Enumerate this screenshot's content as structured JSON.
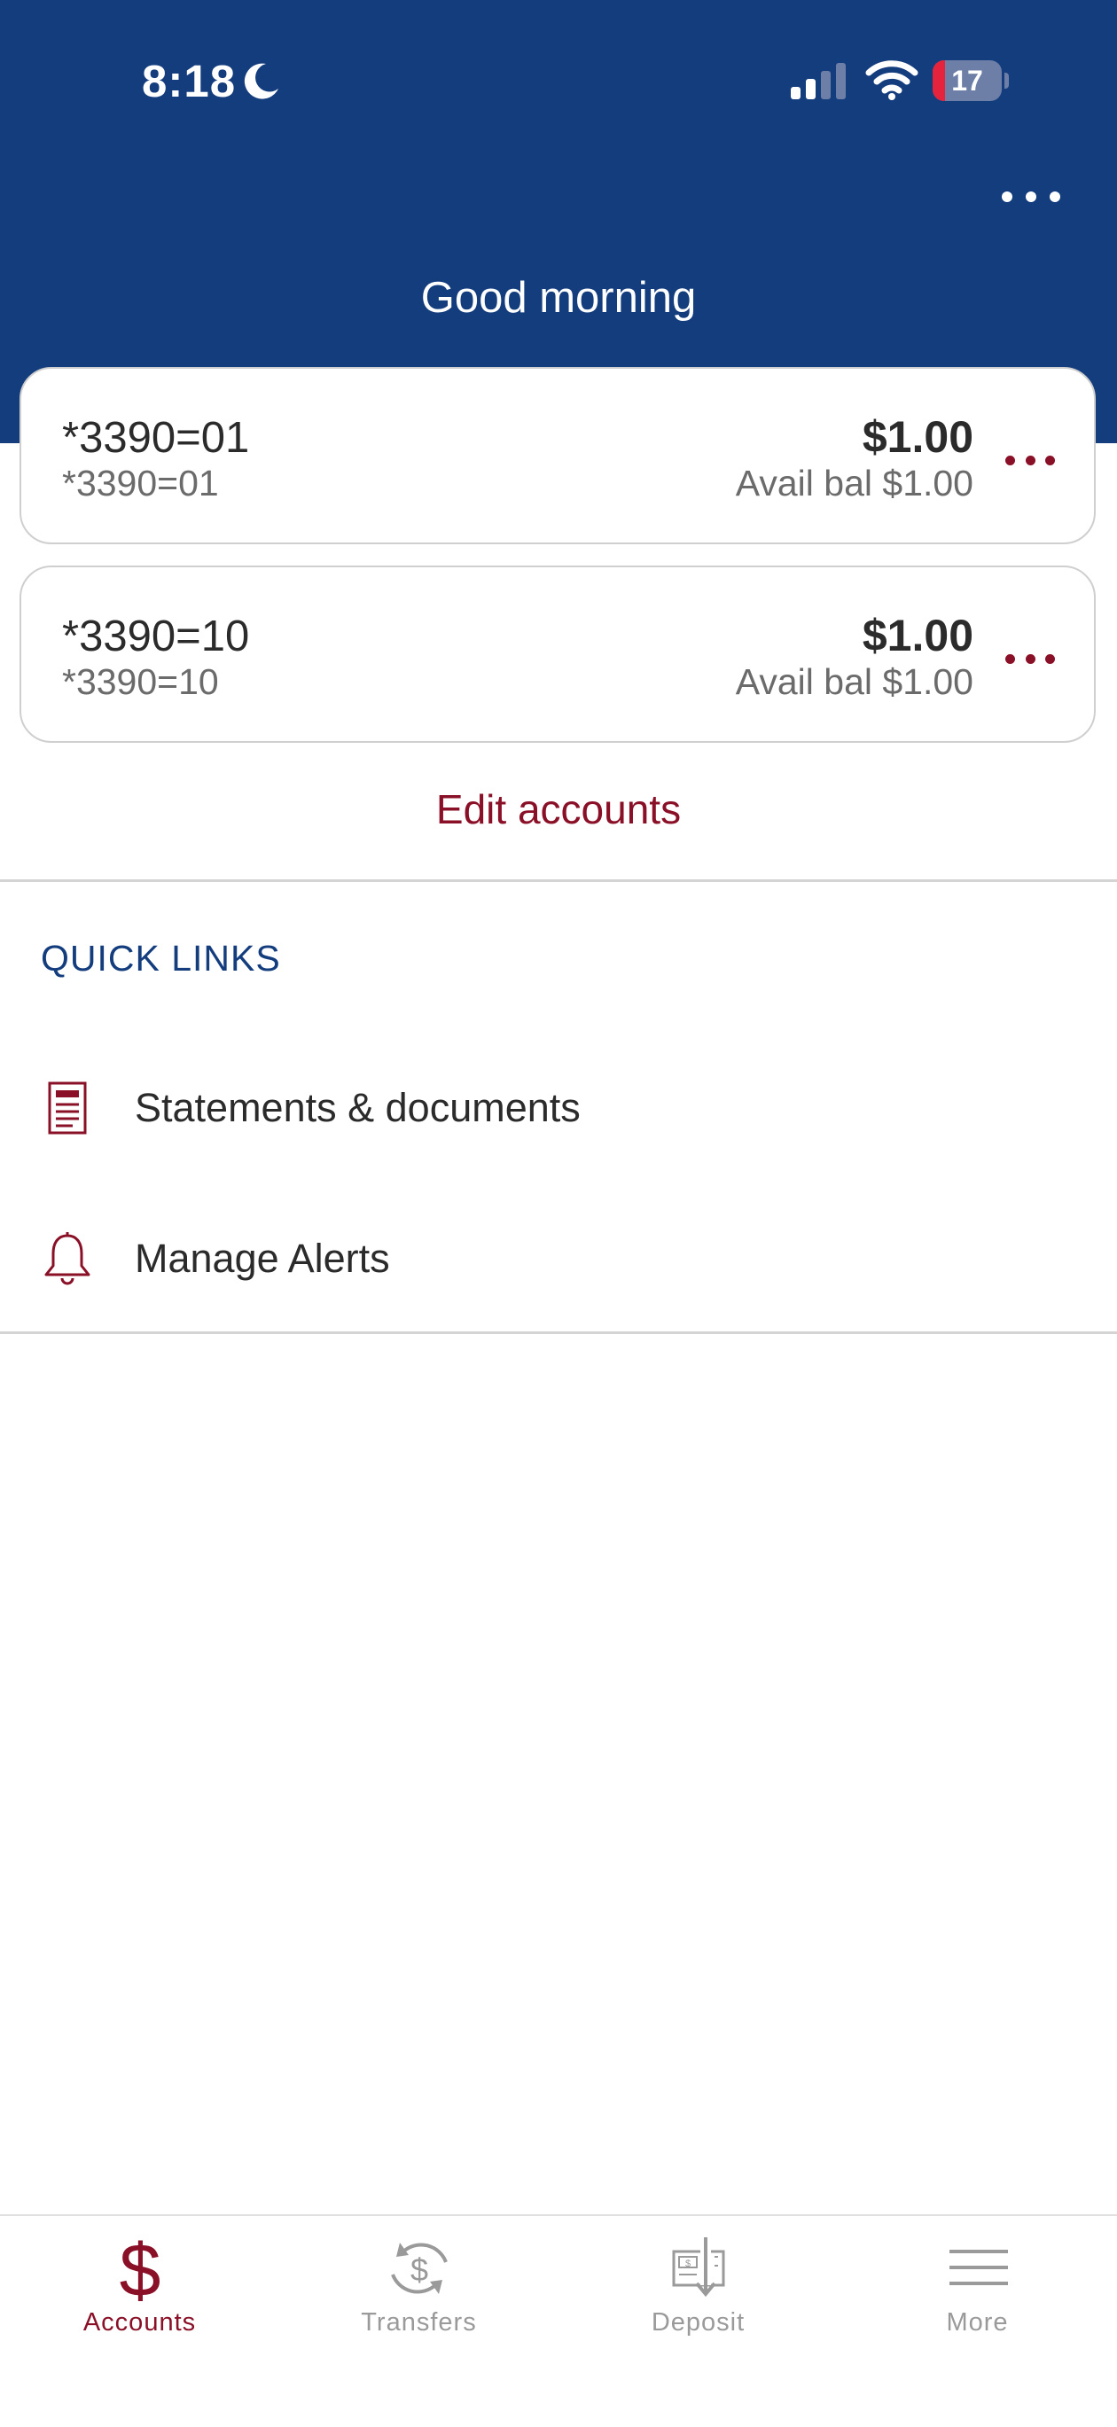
{
  "status_bar": {
    "time": "8:18",
    "battery_level": "17",
    "icons": [
      "moon-icon",
      "cellular-signal-icon",
      "wifi-icon",
      "battery-icon"
    ]
  },
  "header": {
    "greeting": "Good morning",
    "menu_icon": "more-dots-icon"
  },
  "accounts": [
    {
      "name": "*3390=01",
      "number": "*3390=01",
      "balance": "$1.00",
      "available": "Avail bal $1.00"
    },
    {
      "name": "*3390=10",
      "number": "*3390=10",
      "balance": "$1.00",
      "available": "Avail bal $1.00"
    }
  ],
  "edit_accounts_label": "Edit accounts",
  "quick_links": {
    "title": "QUICK LINKS",
    "items": [
      {
        "label": "Statements & documents",
        "icon": "document-icon"
      },
      {
        "label": "Manage Alerts",
        "icon": "bell-icon"
      }
    ]
  },
  "tabbar": {
    "tabs": [
      {
        "label": "Accounts",
        "icon": "dollar-icon",
        "active": true
      },
      {
        "label": "Transfers",
        "icon": "transfer-icon",
        "active": false
      },
      {
        "label": "Deposit",
        "icon": "check-deposit-icon",
        "active": false
      },
      {
        "label": "More",
        "icon": "hamburger-icon",
        "active": false
      }
    ]
  },
  "colors": {
    "header_blue": "#143d7e",
    "accent_red": "#8a1027",
    "inactive_gray": "#9a9a9a"
  }
}
